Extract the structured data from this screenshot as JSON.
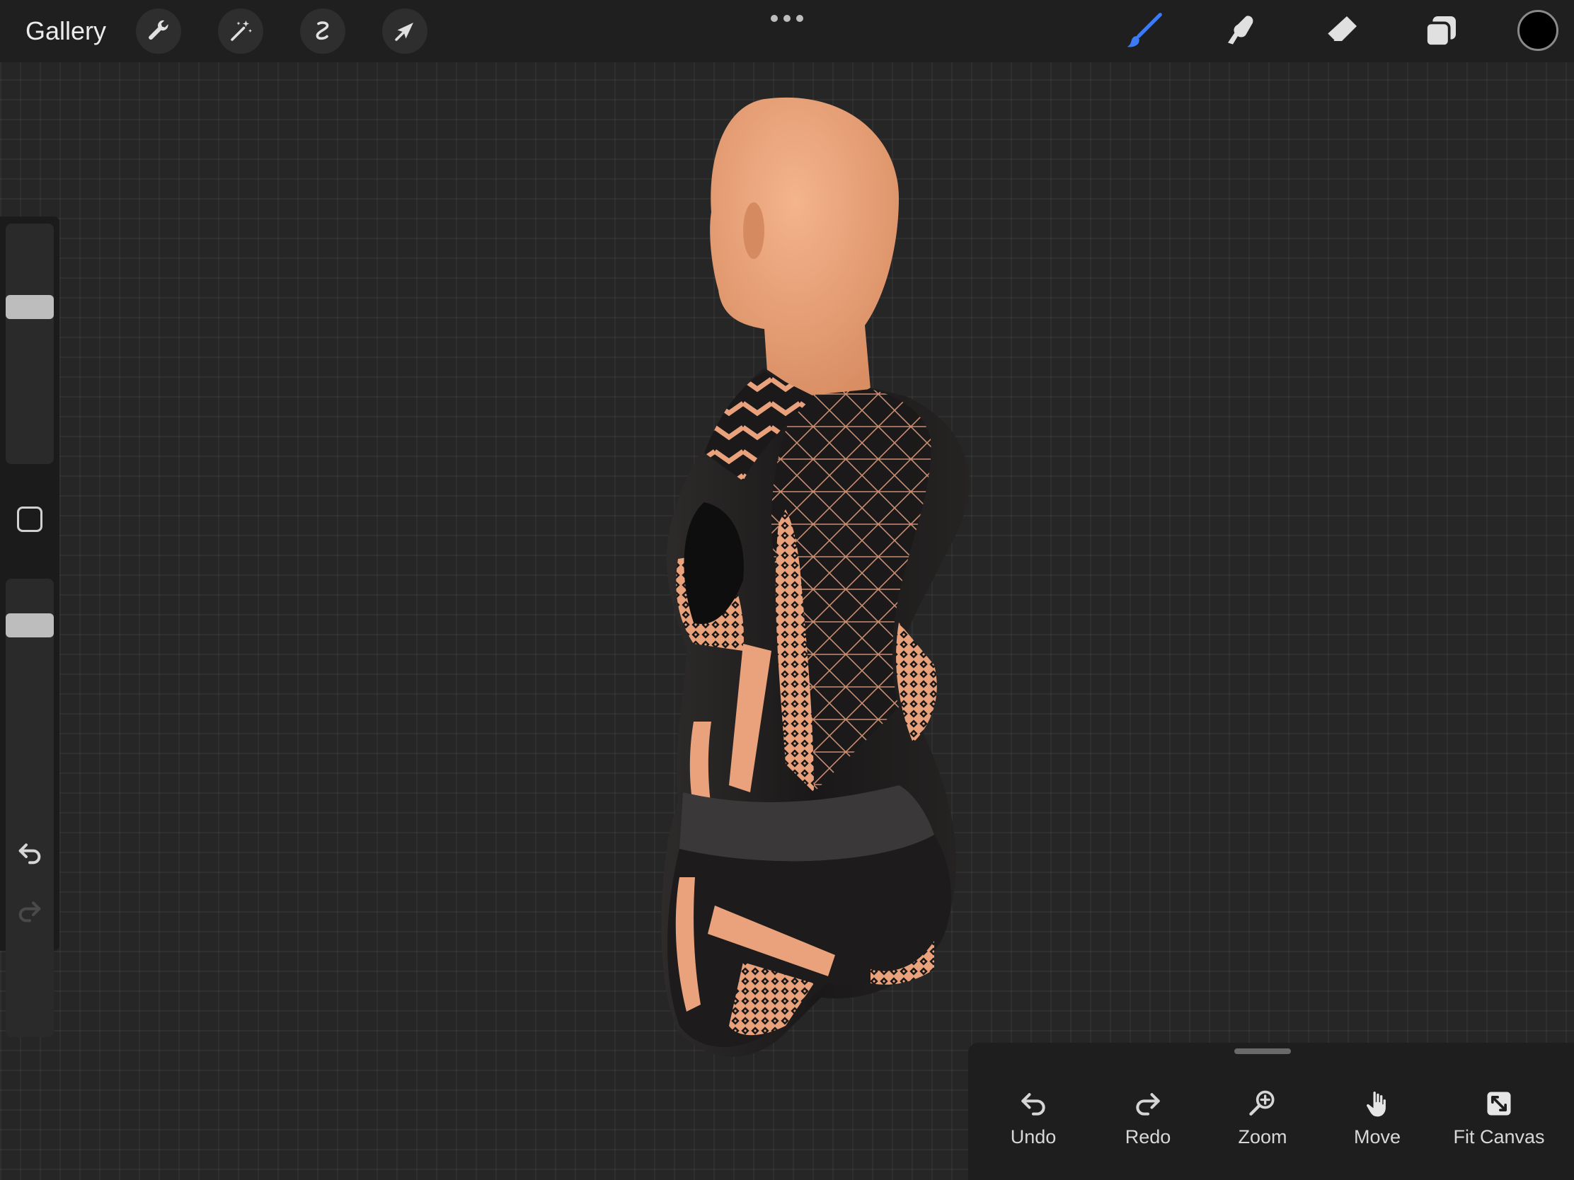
{
  "toolbar": {
    "gallery_label": "Gallery",
    "left_tools": [
      "wrench-icon",
      "magic-wand-icon",
      "selection-icon",
      "transform-arrow-icon"
    ],
    "right_tools": [
      "brush-icon",
      "smudge-icon",
      "eraser-icon",
      "layers-icon"
    ],
    "active_tool": "brush-icon",
    "active_color": "#000000",
    "accent_color": "#3b7bf7"
  },
  "sidebar": {
    "brush_size_level": 0.67,
    "opacity_level": 0.92,
    "icons": [
      "modify-square-icon",
      "undo-icon",
      "redo-icon"
    ]
  },
  "gesture_panel": {
    "buttons": [
      {
        "label": "Undo",
        "icon": "undo-icon"
      },
      {
        "label": "Redo",
        "icon": "redo-icon"
      },
      {
        "label": "Zoom",
        "icon": "zoom-icon"
      },
      {
        "label": "Move",
        "icon": "hand-icon"
      },
      {
        "label": "Fit Canvas",
        "icon": "fit-canvas-icon"
      }
    ]
  },
  "canvas": {
    "subject": "3d-mannequin-bodysuit",
    "skin_color": "#eba27a",
    "suit_color": "#1c1a1a"
  }
}
